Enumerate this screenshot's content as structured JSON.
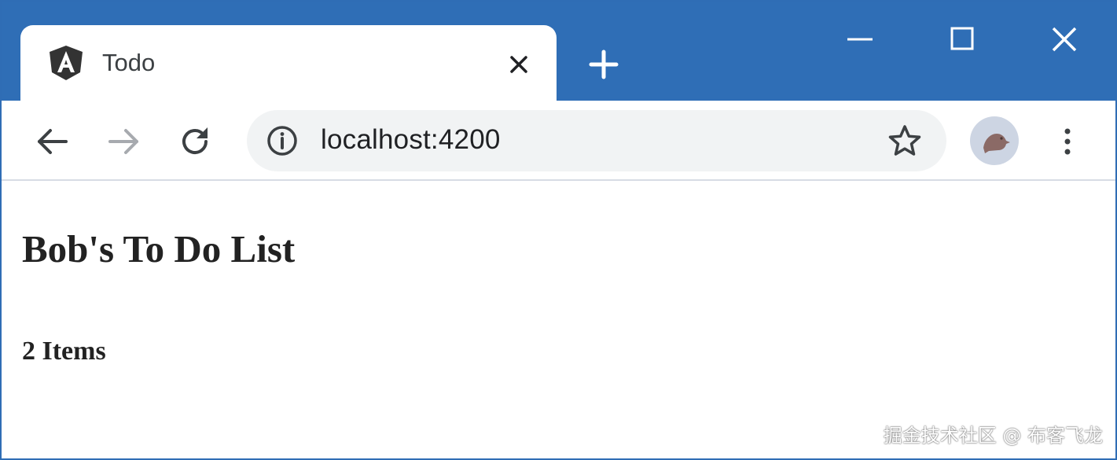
{
  "browser": {
    "tab": {
      "title": "Todo",
      "icon": "angular-icon"
    },
    "address_bar": {
      "url": "localhost:4200"
    },
    "colors": {
      "titlebar": "#2f6eb6",
      "omnibox": "#f1f3f4"
    }
  },
  "page": {
    "heading": "Bob's To Do List",
    "item_count": "2 Items"
  },
  "watermark": "掘金技术社区 @ 布客飞龙"
}
